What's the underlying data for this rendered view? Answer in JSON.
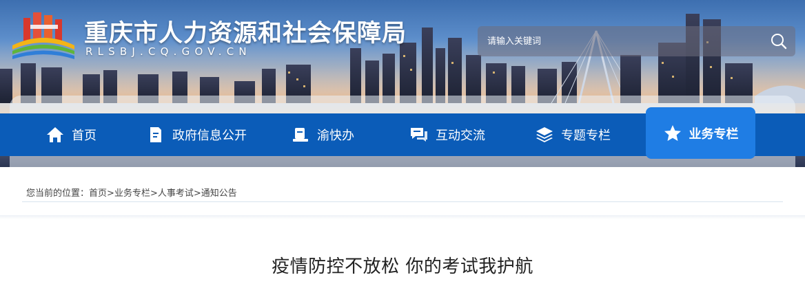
{
  "header": {
    "site_title": "重庆市人力资源和社会保障局",
    "site_url": "RLSBJ.CQ.GOV.CN",
    "search_placeholder": "请输入关键词"
  },
  "nav": {
    "items": [
      {
        "label": "首页",
        "icon": "home-icon"
      },
      {
        "label": "政府信息公开",
        "icon": "document-icon"
      },
      {
        "label": "渝快办",
        "icon": "book-icon"
      },
      {
        "label": "互动交流",
        "icon": "chat-icon"
      },
      {
        "label": "专题专栏",
        "icon": "layers-icon"
      },
      {
        "label": "业务专栏",
        "icon": "star-icon",
        "active": true
      }
    ]
  },
  "breadcrumb": {
    "prefix": "您当前的位置：",
    "items": [
      "首页",
      "业务专栏",
      "人事考试",
      "通知公告"
    ],
    "separator": ">"
  },
  "article": {
    "title": "疫情防控不放松 你的考试我护航"
  },
  "colors": {
    "nav_background": "#0b5cb8",
    "nav_active": "#1f7de4",
    "text": "#222222"
  }
}
